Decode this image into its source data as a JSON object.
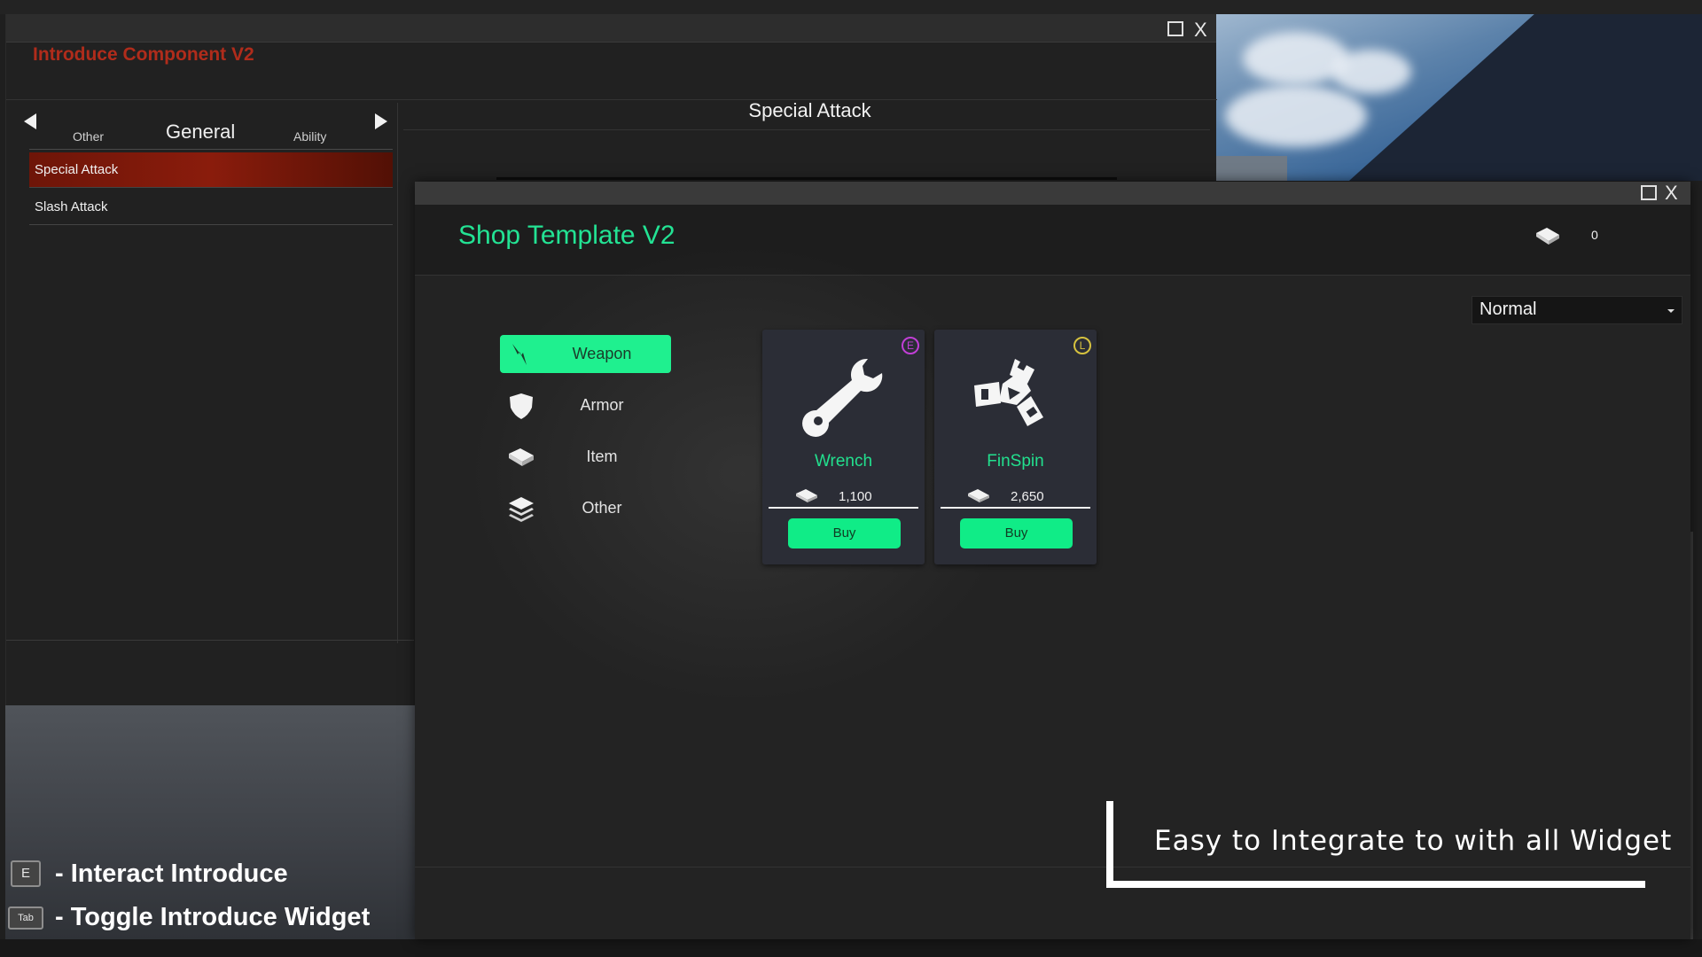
{
  "introduce_window": {
    "title": "Introduce Component V2",
    "tabs": {
      "prev": "Other",
      "current": "General",
      "next": "Ability"
    },
    "list": [
      "Special Attack",
      "Slash Attack"
    ],
    "detail_title": "Special Attack",
    "close_label": "X"
  },
  "shop_window": {
    "title": "Shop Template V2",
    "currency_value": "0",
    "close_label": "X",
    "sort_dropdown": {
      "selected": "Normal"
    },
    "categories": [
      {
        "label": "Weapon",
        "icon": "weapon-icon",
        "active": true
      },
      {
        "label": "Armor",
        "icon": "shield-icon",
        "active": false
      },
      {
        "label": "Item",
        "icon": "currency-bar-icon",
        "active": false
      },
      {
        "label": "Other",
        "icon": "stack-icon",
        "active": false
      }
    ],
    "items": [
      {
        "name": "Wrench",
        "price": "1,100",
        "rarity": "E",
        "rarity_color": "#c13fd6",
        "icon": "wrench-icon",
        "buy_label": "Buy"
      },
      {
        "name": "FinSpin",
        "price": "2,650",
        "rarity": "L",
        "rarity_color": "#d6c23f",
        "icon": "finspin-icon",
        "buy_label": "Buy"
      }
    ]
  },
  "promo": {
    "text": "Easy to Integrate to with all Widget"
  },
  "key_hints": [
    {
      "key": "E",
      "text": "- Interact Introduce"
    },
    {
      "key": "Tab",
      "text": "- Toggle Introduce Widget"
    }
  ],
  "colors": {
    "accent_green": "#1ff08f",
    "title_red": "#b02c1b",
    "selected_red": "#8a1c0c"
  }
}
